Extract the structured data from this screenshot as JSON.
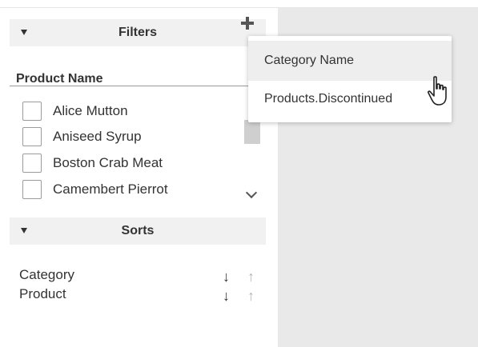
{
  "filters": {
    "header_title": "Filters",
    "field_title": "Product Name",
    "items": [
      {
        "label": "Alice Mutton"
      },
      {
        "label": "Aniseed Syrup"
      },
      {
        "label": "Boston Crab Meat"
      },
      {
        "label": "Camembert Pierrot"
      }
    ]
  },
  "sorts": {
    "header_title": "Sorts",
    "items": [
      {
        "label": "Category"
      },
      {
        "label": "Product"
      }
    ]
  },
  "dropdown": {
    "options": [
      {
        "label": "Category Name"
      },
      {
        "label": "Products.Discontinued"
      }
    ]
  },
  "icons": {
    "caret": "caret-down-icon",
    "add": "plus-icon",
    "remove": "close-icon",
    "sort_desc": "arrow-down-icon",
    "sort_asc": "arrow-up-icon",
    "cursor": "hand-pointer-icon"
  },
  "colors": {
    "panel_bg": "#e9e9e9",
    "header_bg": "#f1f1f1",
    "text": "#333333",
    "muted_arrow": "#b5b5b5",
    "remove_red": "#c0392b"
  }
}
